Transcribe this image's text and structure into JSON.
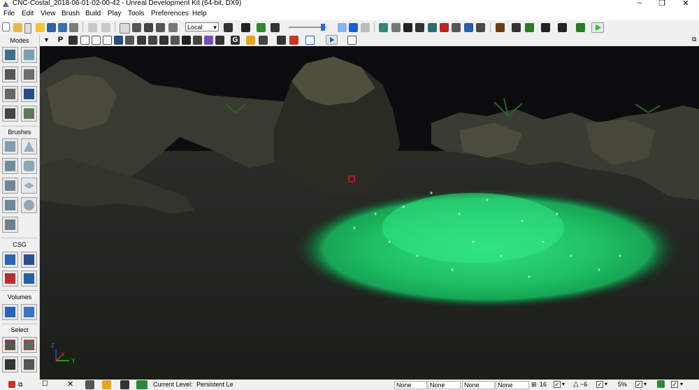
{
  "window": {
    "title": "CNC-Costal_2018-06-01-02-00-42 - Unreal Development Kit (64-bit, DX9)",
    "minimize": "–",
    "maximize": "❐",
    "close": "✕"
  },
  "menu": [
    "File",
    "Edit",
    "View",
    "Brush",
    "Build",
    "Play",
    "Tools",
    "Preferences",
    "Help"
  ],
  "toolbar": {
    "coord_space": "Local"
  },
  "sidebar": {
    "modes_label": "Modes",
    "brushes_label": "Brushes",
    "csg_label": "CSG",
    "volumes_label": "Volumes",
    "select_label": "Select"
  },
  "viewport": {
    "axis_x": "X",
    "axis_y": "Y",
    "axis_z": "Z"
  },
  "statusbar": {
    "current_level_label": "Current Level:",
    "current_level_value": "Persistent Le",
    "fields": [
      "None",
      "None",
      "None",
      "None"
    ],
    "grid_size": "16",
    "rotation_snap": "~6",
    "scale_snap": "5%"
  },
  "colors": {
    "foliage_highlight": "#2ee07a",
    "play_button": "#29c22b",
    "viewport_bg": "#1c1d19"
  }
}
